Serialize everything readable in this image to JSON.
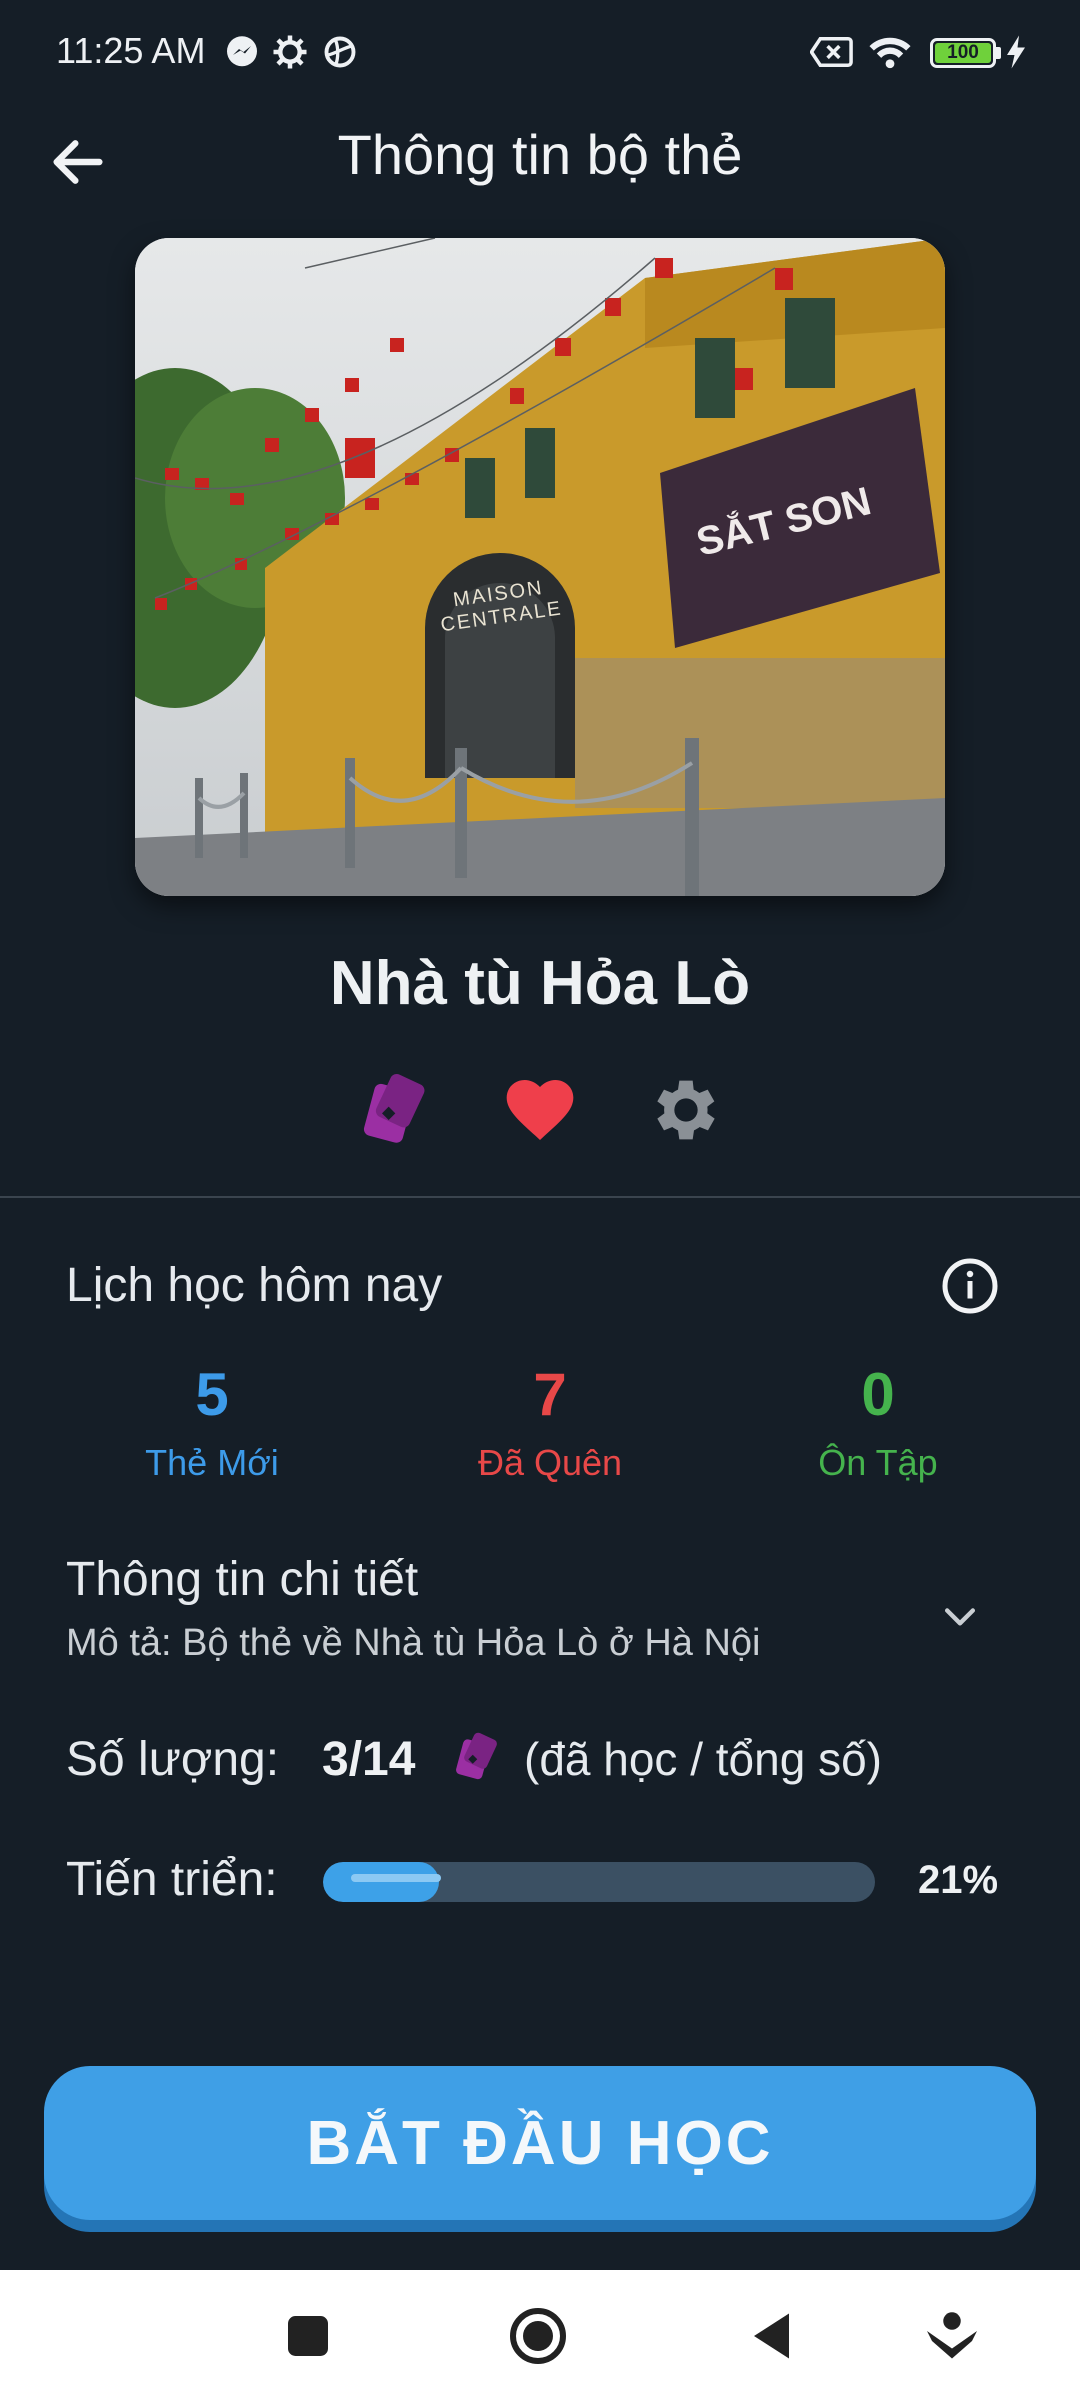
{
  "status_bar": {
    "time": "11:25 AM",
    "battery": "100",
    "icons": [
      "messenger-icon",
      "settings-icon",
      "vpn-icon",
      "sim-off-icon",
      "wifi-icon",
      "battery-icon",
      "charging-icon"
    ]
  },
  "header": {
    "title": "Thông tin bộ thẻ",
    "back_icon": "arrow-left-icon"
  },
  "deck": {
    "name": "Nhà tù Hỏa Lò",
    "cover_sign_text": "MAISON CENTRALE",
    "poster_text": "SẮT SON",
    "actions": [
      "cards-icon",
      "heart-icon",
      "gear-icon"
    ]
  },
  "schedule": {
    "title": "Lịch học hôm nay",
    "stats": [
      {
        "value": "5",
        "label": "Thẻ Mới",
        "color": "#3d9be9"
      },
      {
        "value": "7",
        "label": "Đã Quên",
        "color": "#e84848"
      },
      {
        "value": "0",
        "label": "Ôn Tập",
        "color": "#45b34d"
      }
    ]
  },
  "details": {
    "title": "Thông tin chi tiết",
    "description": "Mô tả:  Bộ thẻ về Nhà tù Hỏa Lò ở Hà Nội",
    "quantity_label": "Số lượng:",
    "quantity_value": "3/14",
    "quantity_note": "(đã học / tổng số)",
    "progress_label": "Tiến triển:",
    "progress_percent_text": "21%",
    "progress_fraction": 0.21
  },
  "start_button": {
    "label": "BẮT ĐẦU HỌC"
  },
  "colors": {
    "background": "#151e27",
    "accent": "#3f9fe6",
    "cards_icon": "#9b2fa3",
    "heart": "#ef3f4b",
    "gear": "#8a9096"
  }
}
